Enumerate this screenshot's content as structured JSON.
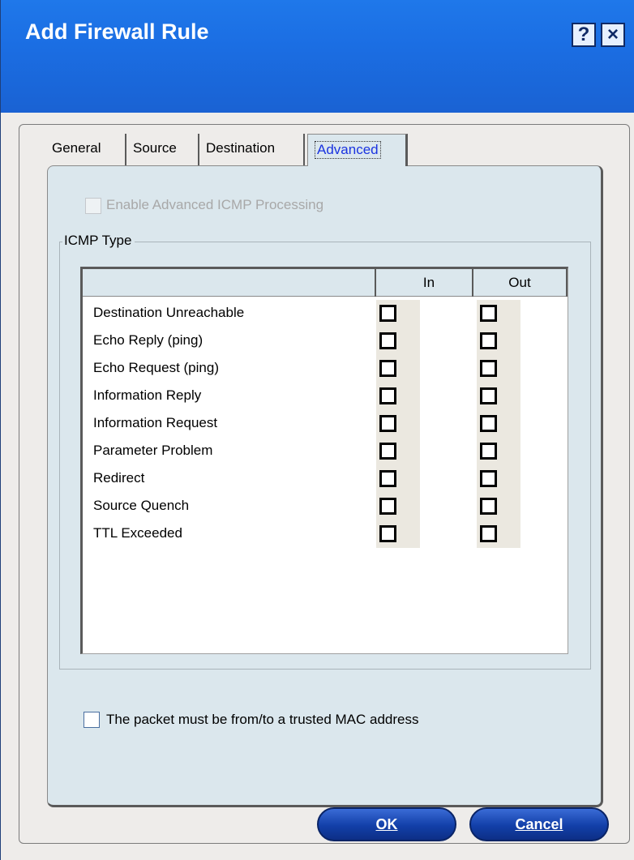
{
  "window": {
    "title": "Add Firewall Rule",
    "help_glyph": "?",
    "close_glyph": "×"
  },
  "tabs": [
    {
      "label": "General"
    },
    {
      "label": "Source"
    },
    {
      "label": "Destination"
    },
    {
      "label": "Advanced",
      "active": true
    }
  ],
  "advanced": {
    "enable_icmp_label": "Enable Advanced ICMP Processing",
    "enable_icmp_checked": false,
    "enable_icmp_disabled": true,
    "icmp_group_label": "ICMP Type",
    "columns": {
      "name": "",
      "in": "In",
      "out": "Out"
    },
    "icmp_types": [
      {
        "name": "Destination Unreachable",
        "in": false,
        "out": false
      },
      {
        "name": "Echo Reply (ping)",
        "in": false,
        "out": false
      },
      {
        "name": "Echo Request (ping)",
        "in": false,
        "out": false
      },
      {
        "name": "Information Reply",
        "in": false,
        "out": false
      },
      {
        "name": "Information Request",
        "in": false,
        "out": false
      },
      {
        "name": "Parameter Problem",
        "in": false,
        "out": false
      },
      {
        "name": "Redirect",
        "in": false,
        "out": false
      },
      {
        "name": "Source Quench",
        "in": false,
        "out": false
      },
      {
        "name": "TTL Exceeded",
        "in": false,
        "out": false
      }
    ],
    "trusted_mac_label": "The packet must be from/to a trusted MAC address",
    "trusted_mac_checked": false
  },
  "buttons": {
    "ok": "OK",
    "cancel": "Cancel"
  },
  "colors": {
    "titlebar": "#1b6ee3",
    "panel": "#dbe7ed",
    "active_tab_text": "#1a33e0",
    "button": "#123fa8"
  }
}
